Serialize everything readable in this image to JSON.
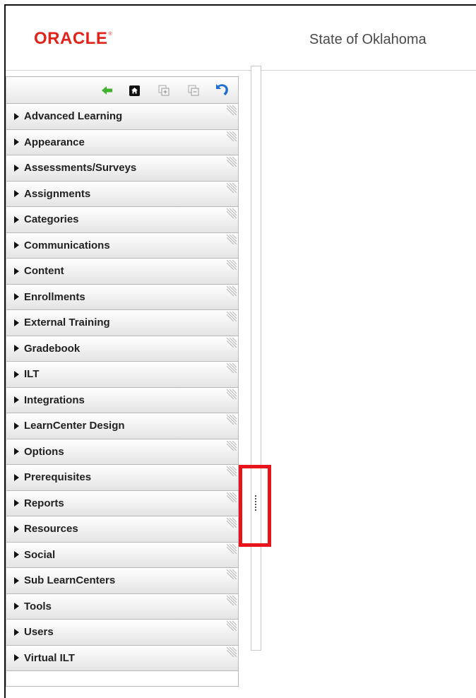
{
  "header": {
    "logo_text": "ORACLE",
    "logo_mark": "®",
    "org_name": "State of Oklahoma"
  },
  "toolbar": {
    "icons": [
      "back-arrow-icon",
      "home-icon",
      "expand-all-icon",
      "collapse-all-icon",
      "refresh-icon"
    ]
  },
  "nav": {
    "items": [
      {
        "label": "Advanced Learning"
      },
      {
        "label": "Appearance"
      },
      {
        "label": "Assessments/Surveys"
      },
      {
        "label": "Assignments"
      },
      {
        "label": "Categories"
      },
      {
        "label": "Communications"
      },
      {
        "label": "Content"
      },
      {
        "label": "Enrollments"
      },
      {
        "label": "External Training"
      },
      {
        "label": "Gradebook"
      },
      {
        "label": "ILT"
      },
      {
        "label": "Integrations"
      },
      {
        "label": "LearnCenter Design"
      },
      {
        "label": "Options"
      },
      {
        "label": "Prerequisites"
      },
      {
        "label": "Reports"
      },
      {
        "label": "Resources"
      },
      {
        "label": "Social"
      },
      {
        "label": "Sub LearnCenters"
      },
      {
        "label": "Tools"
      },
      {
        "label": "Users"
      },
      {
        "label": "Virtual ILT"
      }
    ]
  },
  "colors": {
    "brand_red": "#e2231a",
    "highlight_red": "#e8141c",
    "back_arrow_green": "#3db22a",
    "refresh_blue": "#1f6fd1"
  }
}
